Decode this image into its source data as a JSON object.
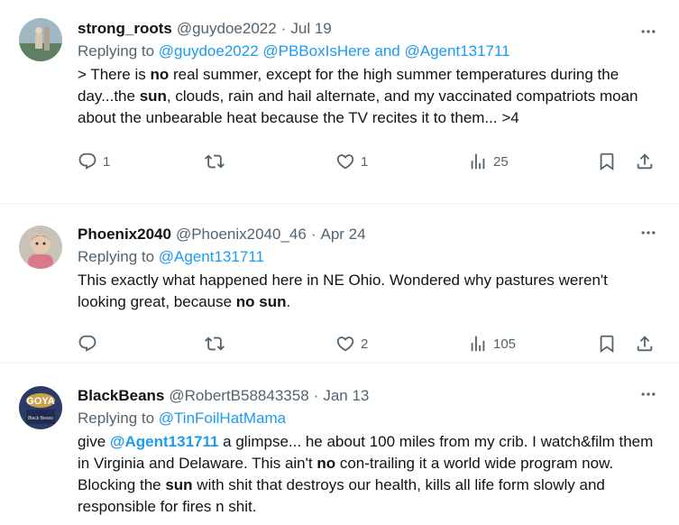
{
  "tweets": [
    {
      "name": "strong_roots",
      "handle": "@guydoe2022",
      "separator": "·",
      "date": "Jul 19",
      "replying_label": "Replying to",
      "replying_mentions": "@guydoe2022 @PBBoxIsHere and @Agent131711",
      "text_parts": [
        "> There is ",
        "no",
        " real summer, except for the high summer temperatures during the day...the ",
        "sun",
        ", clouds, rain and hail alternate, and my vaccinated compatriots moan about the unbearable heat because the TV recites it to them... >4"
      ],
      "replies": "1",
      "retweets": "",
      "likes": "1",
      "views": "25"
    },
    {
      "name": "Phoenix2040",
      "handle": "@Phoenix2040_46",
      "separator": "·",
      "date": "Apr 24",
      "replying_label": "Replying to",
      "replying_mentions": "@Agent131711",
      "text_parts": [
        "This exactly what happened here in NE Ohio. Wondered why pastures weren't looking great, because ",
        "no sun",
        "."
      ],
      "replies": "",
      "retweets": "",
      "likes": "2",
      "views": "105"
    },
    {
      "name": "BlackBeans",
      "handle": "@RobertB58843358",
      "separator": "·",
      "date": "Jan 13",
      "replying_label": "Replying to",
      "replying_mentions": "@TinFoilHatMama",
      "text_parts": [
        "give ",
        "@Agent131711",
        "  a glimpse... he about 100 miles from my crib.  I watch&film them in Virginia and Delaware. This ain't ",
        "no",
        " con-trailing it a world wide program now. Blocking the ",
        "sun",
        " with shit that destroys our health, kills all life form slowly and responsible for fires n shit."
      ]
    }
  ],
  "colors": {
    "text": "#0f1419",
    "secondary": "#536471",
    "link": "#1d9bf0",
    "divider": "#eff3f4"
  }
}
